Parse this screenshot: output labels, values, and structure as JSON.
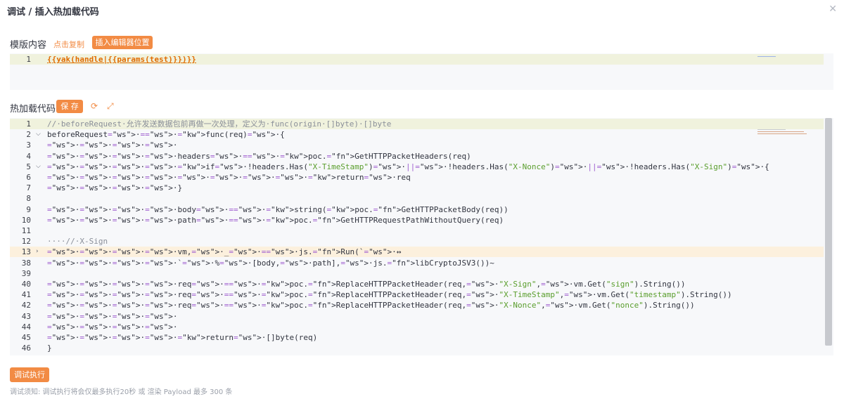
{
  "dialog": {
    "title": "调试 / 插入热加载代码",
    "close_icon": "close-icon"
  },
  "template_section": {
    "label": "模版内容",
    "copy_link": "点击复制",
    "insert_button": "插入编辑器位置",
    "lines": [
      {
        "n": "1",
        "text": "{{yak(handle|{{params(test)}})}}"
      }
    ]
  },
  "hotload_section": {
    "label": "热加载代码",
    "save_button": "保 存",
    "refresh_icon": "refresh-icon",
    "expand_icon": "expand-icon",
    "lines": [
      {
        "n": "1",
        "text": "//·beforeRequest·允许发送数据包前再做一次处理，定义为·func(origin·[]byte)·[]byte"
      },
      {
        "n": "2",
        "text": "beforeRequest·=·func(req)·{"
      },
      {
        "n": "3",
        "text": "····"
      },
      {
        "n": "4",
        "text": "····headers·=·poc.GetHTTPPacketHeaders(req)"
      },
      {
        "n": "5",
        "text": "····if·!headers.Has(\"X-TimeStamp\")·||·!headers.Has(\"X-Nonce\")·||·!headers.Has(\"X-Sign\")·{"
      },
      {
        "n": "6",
        "text": "········return·req"
      },
      {
        "n": "7",
        "text": "····}"
      },
      {
        "n": "8",
        "text": ""
      },
      {
        "n": "9",
        "text": "····body·=·string(poc.GetHTTPPacketBody(req))"
      },
      {
        "n": "10",
        "text": "····path·=·poc.GetHTTPRequestPathWithoutQuery(req)"
      },
      {
        "n": "11",
        "text": ""
      },
      {
        "n": "12",
        "text": "····//·X-Sign"
      },
      {
        "n": "13",
        "text": "····vm,·_·=·js.Run(`·↔"
      },
      {
        "n": "38",
        "text": "····`·%·[body,·path],·js.libCryptoJSV3())~"
      },
      {
        "n": "39",
        "text": ""
      },
      {
        "n": "40",
        "text": "····req·=·poc.ReplaceHTTPPacketHeader(req,·\"X-Sign\",·vm.Get(\"sign\").String())"
      },
      {
        "n": "41",
        "text": "····req·=·poc.ReplaceHTTPPacketHeader(req,·\"X-TimeStamp\",·vm.Get(\"timestamp\").String())"
      },
      {
        "n": "42",
        "text": "····req·=·poc.ReplaceHTTPPacketHeader(req,·\"X-Nonce\",·vm.Get(\"nonce\").String())"
      },
      {
        "n": "43",
        "text": "····"
      },
      {
        "n": "44",
        "text": "····"
      },
      {
        "n": "45",
        "text": "····return·[]byte(req)"
      },
      {
        "n": "46",
        "text": "}"
      }
    ]
  },
  "footer": {
    "run_button": "调试执行",
    "note": "调试须知: 调试执行将会仅最多执行20秒 或 渲染 Payload 最多 300 条"
  },
  "colors": {
    "accent": "#f28b44",
    "editor_bg": "#f7f8fa",
    "highlight_line": "#f0f2dd",
    "fold_line": "#fcf0dd"
  }
}
